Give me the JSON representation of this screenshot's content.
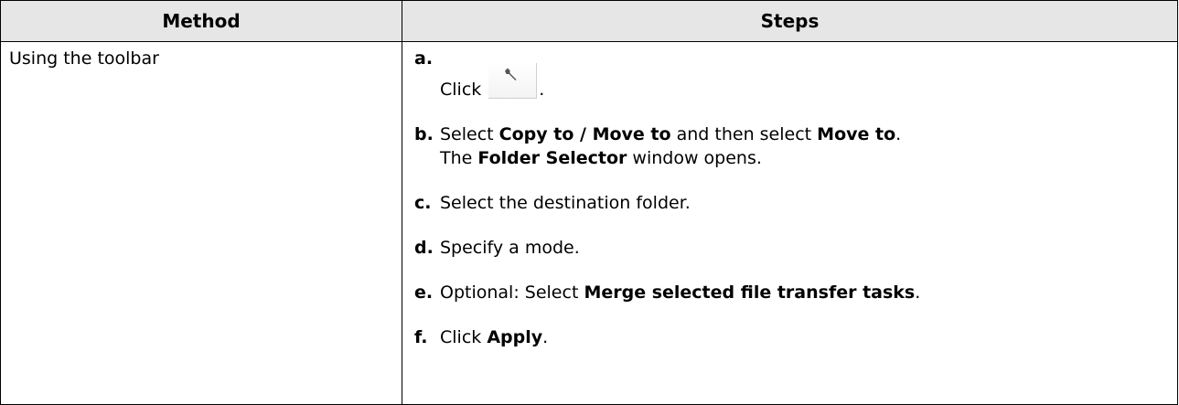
{
  "table": {
    "headers": {
      "method": "Method",
      "steps": "Steps"
    },
    "method": "Using the toolbar",
    "steps": {
      "a": {
        "letter": "a.",
        "text_before": "Click",
        "text_after": "."
      },
      "b": {
        "letter": "b.",
        "t1": "Select",
        "b1": "Copy to / Move to",
        "t2": "and then select",
        "b2": "Move to",
        "t3": ".",
        "t4": "The",
        "b3": "Folder Selector",
        "t5": "window opens."
      },
      "c": {
        "letter": "c.",
        "text": "Select the destination folder."
      },
      "d": {
        "letter": "d.",
        "text": "Specify a mode."
      },
      "e": {
        "letter": "e.",
        "t1": "Optional: Select",
        "b1": "Merge selected file transfer tasks",
        "t2": "."
      },
      "f": {
        "letter": "f.",
        "t1": "Click",
        "b1": "Apply",
        "t2": "."
      }
    }
  },
  "icons": {
    "toolbar_button": "wrench-icon"
  }
}
